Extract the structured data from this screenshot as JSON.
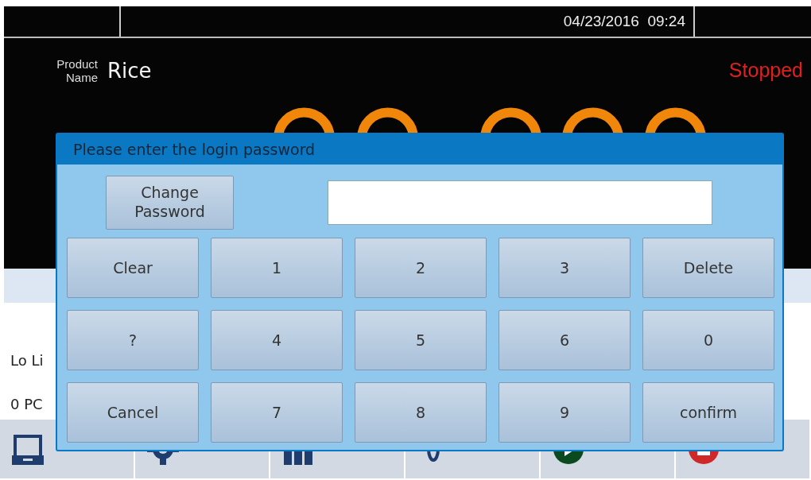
{
  "header": {
    "datetime": "04/23/2016  09:24"
  },
  "product": {
    "label": "Product Name",
    "value": "Rice"
  },
  "status": {
    "text": "Stopped",
    "kind": "stopped"
  },
  "fields": [
    {
      "label": "Lo Li"
    },
    {
      "label": "0 PC"
    }
  ],
  "toolbar": [
    {
      "kind": "tray"
    },
    {
      "kind": "gear"
    },
    {
      "kind": "bars"
    },
    {
      "kind": "zero"
    },
    {
      "kind": "play"
    },
    {
      "kind": "stop"
    }
  ],
  "dialog": {
    "title": "Please enter the login password",
    "change_password": "Change Password",
    "keys": [
      {
        "label": "Clear"
      },
      {
        "label": "1"
      },
      {
        "label": "2"
      },
      {
        "label": "3"
      },
      {
        "label": "Delete"
      },
      {
        "label": "?"
      },
      {
        "label": "4"
      },
      {
        "label": "5"
      },
      {
        "label": "6"
      },
      {
        "label": "0"
      },
      {
        "label": "Cancel"
      },
      {
        "label": "7"
      },
      {
        "label": "8"
      },
      {
        "label": "9"
      },
      {
        "label": "confirm"
      }
    ]
  }
}
